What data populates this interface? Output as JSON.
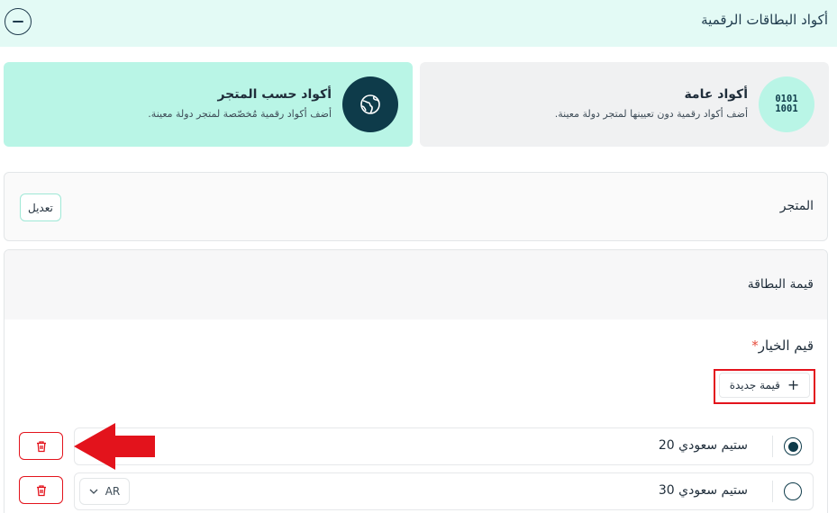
{
  "header": {
    "title": "أكواد البطاقات الرقمية",
    "collapse_icon": "minus-circle-icon"
  },
  "cards": {
    "general": {
      "icon_text": "0101\n1001",
      "title": "أكواد عامة",
      "description": "أضف أكواد رقمية دون تعيينها لمتجر دولة معينة."
    },
    "store": {
      "icon": "globe-icon",
      "title": "أكواد حسب المتجر",
      "description": "أضف أكواد رقمية مُخصّصة لمتجر دولة معينة."
    }
  },
  "store_section": {
    "label": "المتجر",
    "edit_label": "تعديل"
  },
  "value_section": {
    "label": "قيمة البطاقة",
    "options_label": "قيم الخيار",
    "required_mark": "*",
    "new_value_label": "قيمة جديدة"
  },
  "options": [
    {
      "value": "ستيم سعودي 20",
      "selected": true
    },
    {
      "value": "ستيم سعودي 30",
      "selected": false,
      "language": "AR"
    }
  ],
  "colors": {
    "accent": "#0e3b4a",
    "mint": "#b9f5e6",
    "danger": "#e3131c"
  }
}
